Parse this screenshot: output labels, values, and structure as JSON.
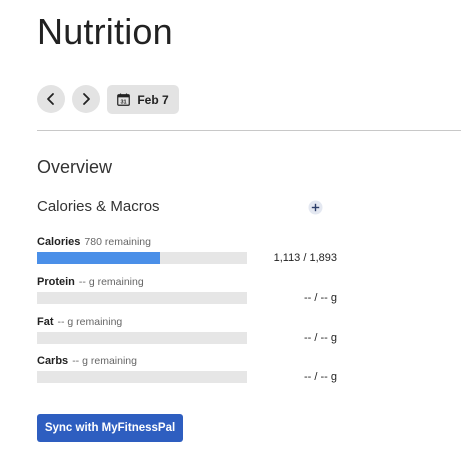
{
  "page": {
    "title": "Nutrition"
  },
  "date_nav": {
    "prev_icon": "chevron-left-icon",
    "next_icon": "chevron-right-icon",
    "calendar_icon": "calendar-icon",
    "calendar_day": "31",
    "date_label": "Feb 7"
  },
  "overview": {
    "title": "Overview",
    "subtitle": "Calories & Macros",
    "add_icon": "plus-circle-icon"
  },
  "macros": [
    {
      "name": "Calories",
      "remaining": "780 remaining",
      "value": "1,113 / 1,893",
      "progress": 0.588
    },
    {
      "name": "Protein",
      "remaining": "-- g remaining",
      "value": "-- / -- g",
      "progress": 0
    },
    {
      "name": "Fat",
      "remaining": "-- g remaining",
      "value": "-- / -- g",
      "progress": 0
    },
    {
      "name": "Carbs",
      "remaining": "-- g remaining",
      "value": "-- / -- g",
      "progress": 0
    }
  ],
  "sync": {
    "label": "Sync with MyFitnessPal"
  },
  "colors": {
    "progress_fill": "#4a8fe8",
    "track": "#e6e6e6",
    "sync_button": "#2e5ec0"
  }
}
